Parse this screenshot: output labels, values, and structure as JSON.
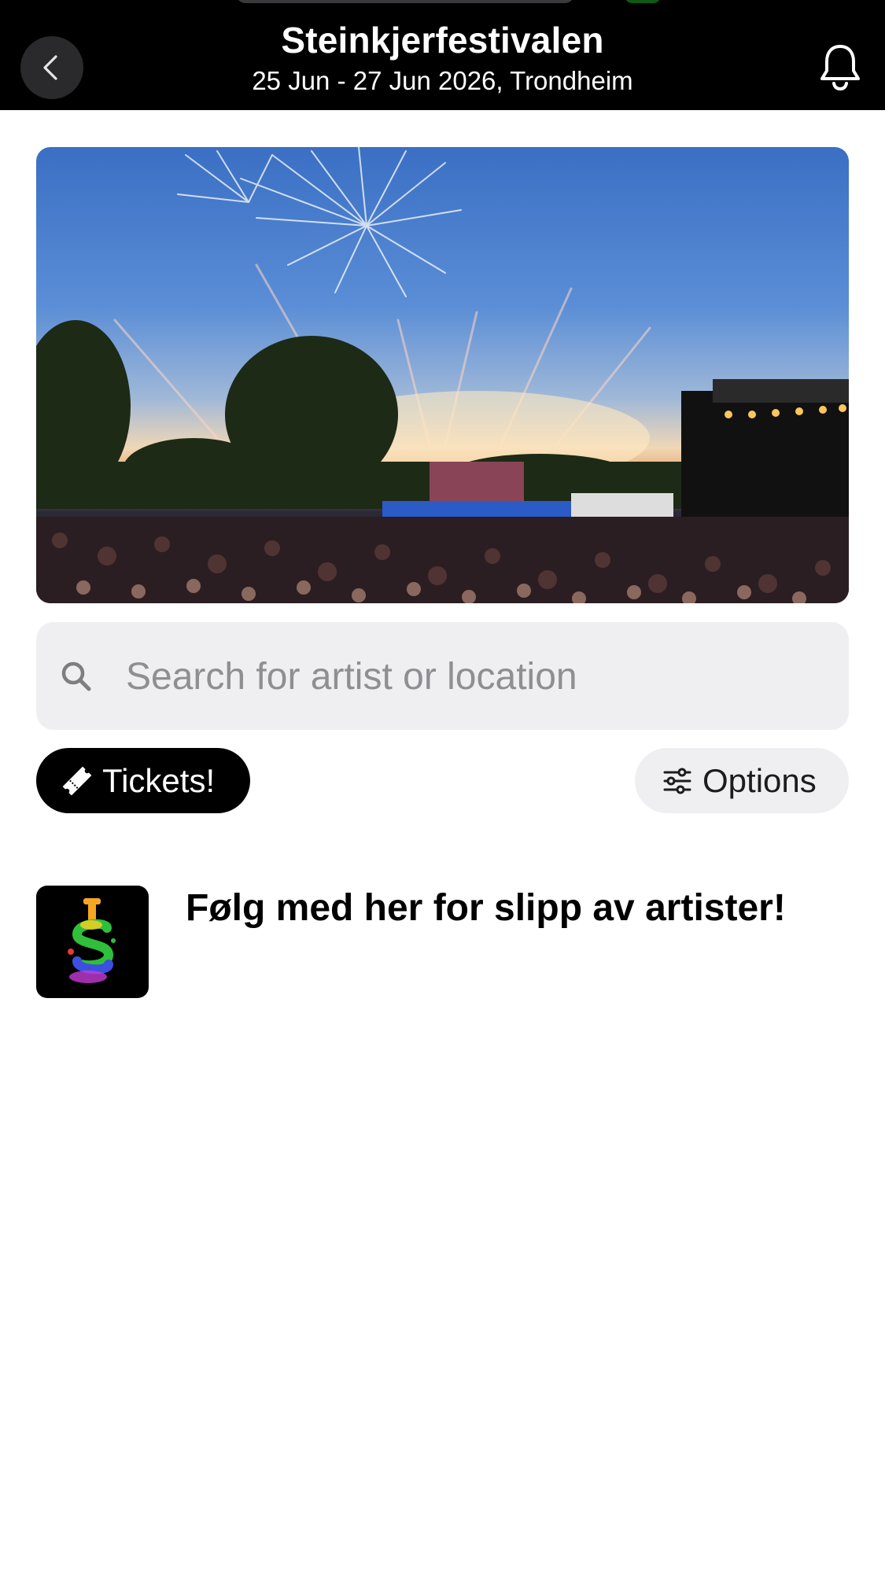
{
  "header": {
    "title": "Steinkjerfestivalen",
    "subtitle": "25 Jun - 27 Jun 2026, Trondheim",
    "back_icon": "chevron-left-icon",
    "notification_icon": "bell-icon"
  },
  "hero": {
    "image": "festival-crowd-fireworks"
  },
  "search": {
    "placeholder": "Search for artist or location",
    "icon": "search-icon"
  },
  "actions": {
    "tickets_label": "Tickets!",
    "tickets_icon": "ticket-icon",
    "options_label": "Options",
    "options_icon": "sliders-icon"
  },
  "announcement": {
    "text": "Følg med her for slipp av artister!",
    "logo": "festival-logo"
  },
  "colors": {
    "header_bg": "#000000",
    "search_bg": "#efeff1",
    "primary_button_bg": "#000000",
    "secondary_button_bg": "#efeff1"
  }
}
